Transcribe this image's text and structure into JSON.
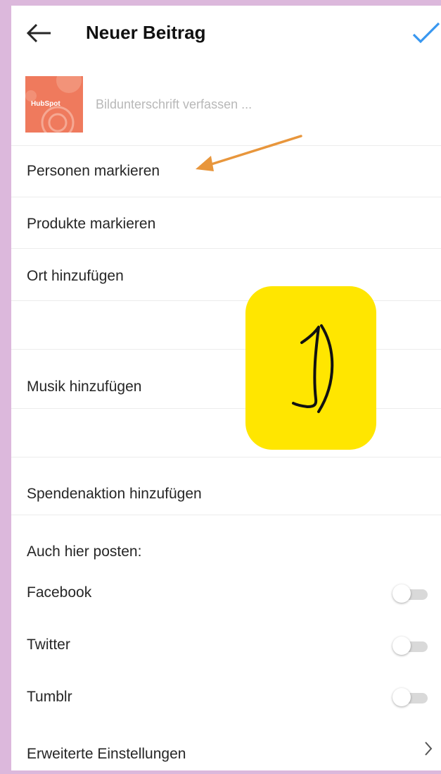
{
  "header": {
    "title": "Neuer Beitrag",
    "back_icon": "back-arrow-icon",
    "confirm_icon": "checkmark-icon",
    "accent_color": "#3897f0"
  },
  "post": {
    "thumbnail_label": "HubSpot",
    "thumbnail_color": "#ef7a5d",
    "caption_placeholder": "Bildunterschrift verfassen ...",
    "caption_value": ""
  },
  "options": {
    "tag_people": "Personen markieren",
    "tag_products": "Produkte markieren",
    "add_location": "Ort hinzufügen",
    "add_music": "Musik hinzufügen",
    "add_fundraiser": "Spendenaktion hinzufügen"
  },
  "share": {
    "heading": "Auch hier posten:",
    "targets": [
      {
        "label": "Facebook",
        "enabled": false
      },
      {
        "label": "Twitter",
        "enabled": false
      },
      {
        "label": "Tumblr",
        "enabled": false
      }
    ]
  },
  "advanced": {
    "label": "Erweiterte Einstellungen",
    "icon": "chevron-right-icon"
  },
  "annotation": {
    "step_label": "1)",
    "sticky_color": "#ffe600",
    "arrow_color": "#e8963c"
  }
}
